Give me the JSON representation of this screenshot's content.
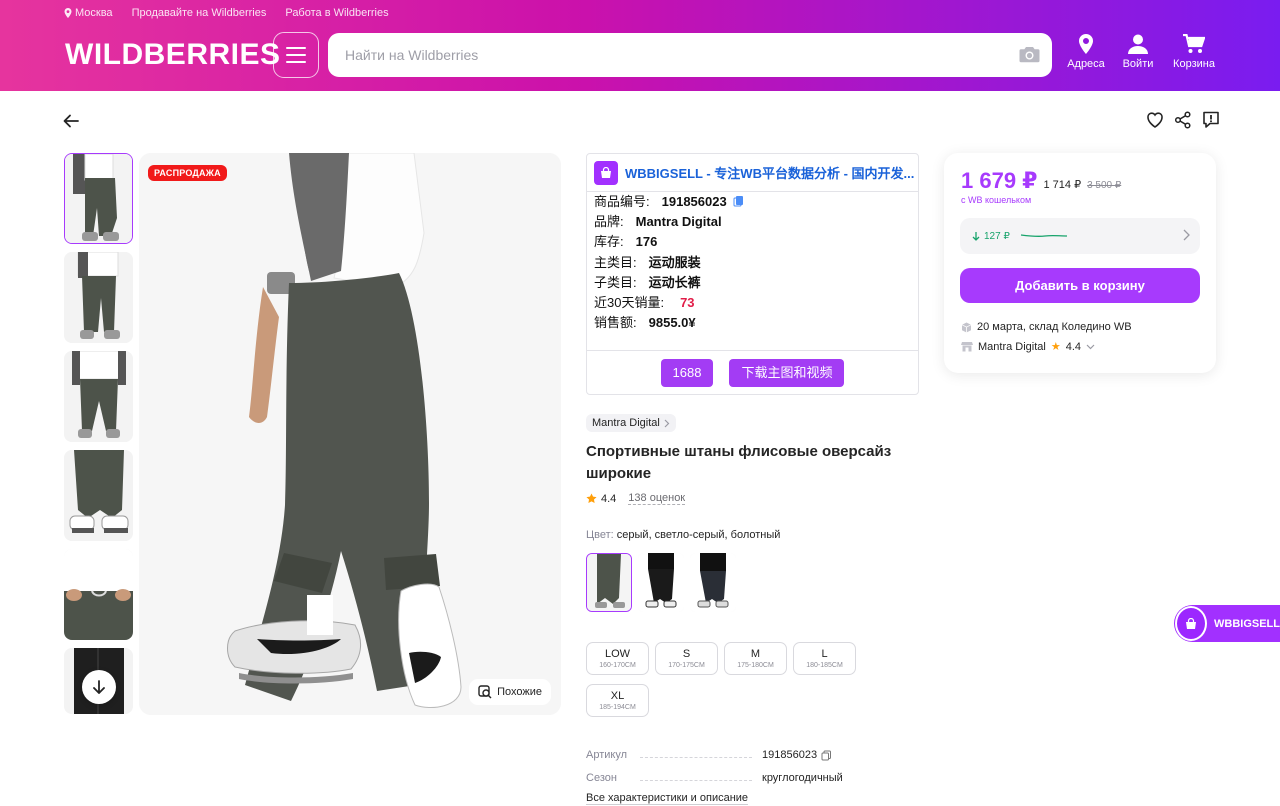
{
  "header": {
    "location": "Москва",
    "sell_link": "Продавайте на Wildberries",
    "job_link": "Работа в Wildberries",
    "logo": "WILDBERRIES",
    "search_placeholder": "Найти на Wildberries",
    "icons": [
      {
        "label": "Адреса",
        "icon": "location-pin-icon"
      },
      {
        "label": "Войти",
        "icon": "user-icon"
      },
      {
        "label": "Корзина",
        "icon": "cart-icon"
      }
    ],
    "colors": {
      "gradient_start": "#e6349e",
      "gradient_end": "#7a1cf0"
    }
  },
  "gallery": {
    "sale_badge": "РАСПРОДАЖА",
    "similar_label": "Похожие",
    "thumb_count": 6
  },
  "plugin": {
    "title": "WBBIGSELL - 专注WB平台数据分析 - 国内开发...",
    "rows": [
      {
        "label": "商品编号:",
        "value": "191856023"
      },
      {
        "label": "品牌:",
        "value": "Mantra Digital"
      },
      {
        "label": "库存:",
        "value": "176"
      },
      {
        "label": "主类目:",
        "value": "运动服装"
      },
      {
        "label": "子类目:",
        "value": "运动长裤"
      },
      {
        "label": "近30天销量:",
        "value": "73"
      },
      {
        "label": "销售额:",
        "value": "9855.0¥"
      }
    ],
    "btn_1688": "1688",
    "btn_download": "下载主图和视频"
  },
  "product": {
    "brand": "Mantra Digital",
    "title": "Спортивные штаны флисовые оверсайз широкие",
    "rating": "4.4",
    "reviews": "138 оценок",
    "color_label": "Цвет:",
    "color_value": "серый, светло-серый, болотный",
    "sizes": [
      {
        "name": "LOW",
        "range": "160-170CM"
      },
      {
        "name": "S",
        "range": "170-175CM"
      },
      {
        "name": "M",
        "range": "175-180CM"
      },
      {
        "name": "L",
        "range": "180-185CM"
      },
      {
        "name": "XL",
        "range": "185-194CM"
      }
    ],
    "specs": [
      {
        "key": "Артикул",
        "value": "191856023"
      },
      {
        "key": "Сезон",
        "value": "круглогодичный"
      }
    ],
    "all_desc": "Все характеристики и описание"
  },
  "price_card": {
    "price": "1 679 ₽",
    "price_no_wallet": "1 714 ₽",
    "old_price": "3 500 ₽",
    "wallet_note": "с WB кошельком",
    "history_delta": "127 ₽",
    "add_to_cart": "Добавить в корзину",
    "delivery": "20 марта, склад Коледино WB",
    "seller": "Mantra Digital",
    "seller_rating": "4.4",
    "accent": "#a73afd"
  },
  "float_widget": {
    "label": "WBBIGSELL"
  }
}
